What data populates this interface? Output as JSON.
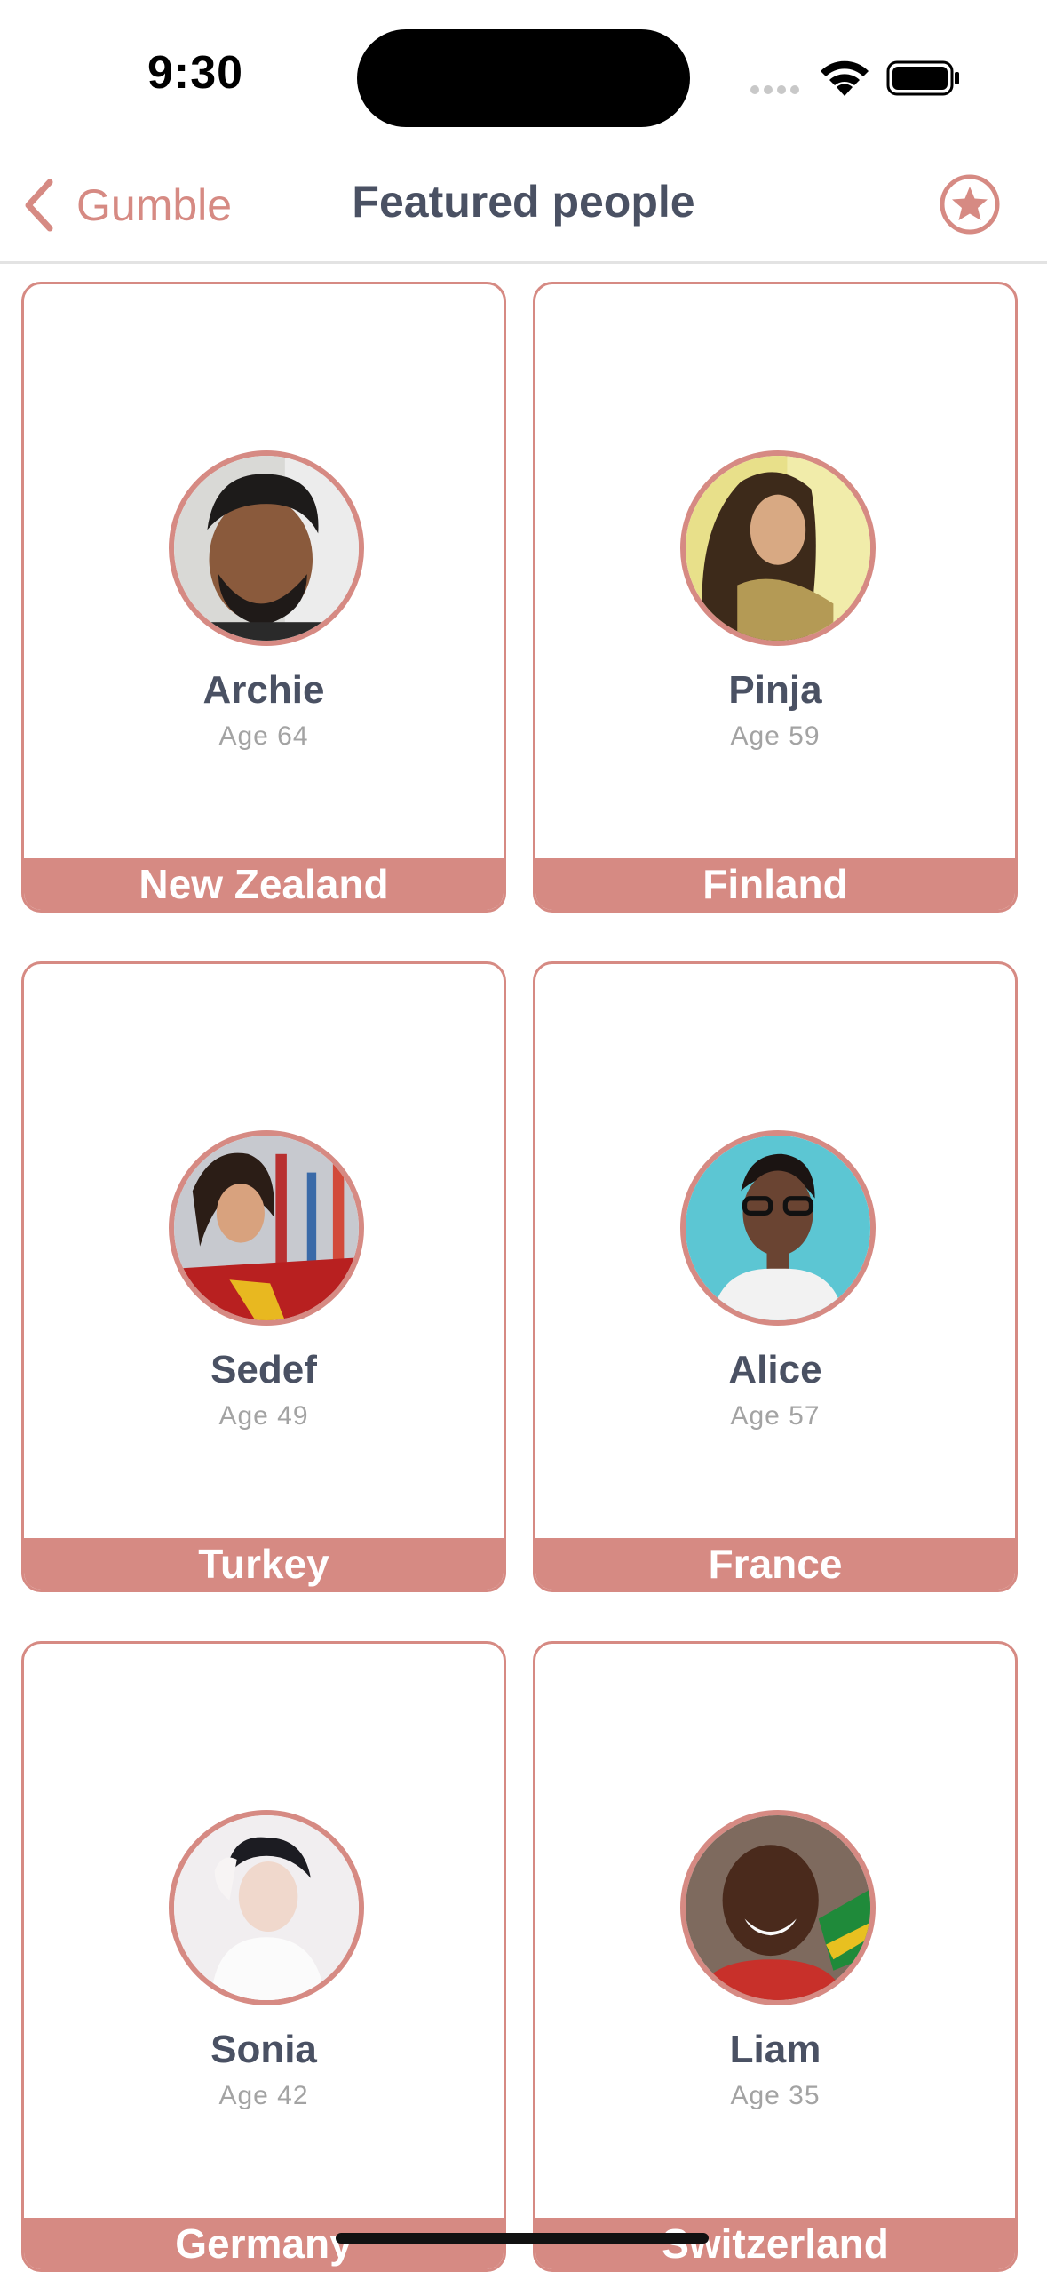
{
  "status_bar": {
    "time": "9:30"
  },
  "nav": {
    "back_label": "Gumble",
    "title": "Featured people"
  },
  "people": [
    {
      "name": "Archie",
      "age": "Age 64",
      "country": "New Zealand"
    },
    {
      "name": "Pinja",
      "age": "Age 59",
      "country": "Finland"
    },
    {
      "name": "Sedef",
      "age": "Age 49",
      "country": "Turkey"
    },
    {
      "name": "Alice",
      "age": "Age 57",
      "country": "France"
    },
    {
      "name": "Sonia",
      "age": "Age 42",
      "country": "Germany"
    },
    {
      "name": "Liam",
      "age": "Age 35",
      "country": "Switzerland"
    }
  ],
  "colors": {
    "accent": "#d68a83",
    "title_text": "#4a5163",
    "secondary_text": "#a3a3a3"
  },
  "icons": {
    "back": "chevron-left-icon",
    "favorite": "star-circle-icon"
  }
}
